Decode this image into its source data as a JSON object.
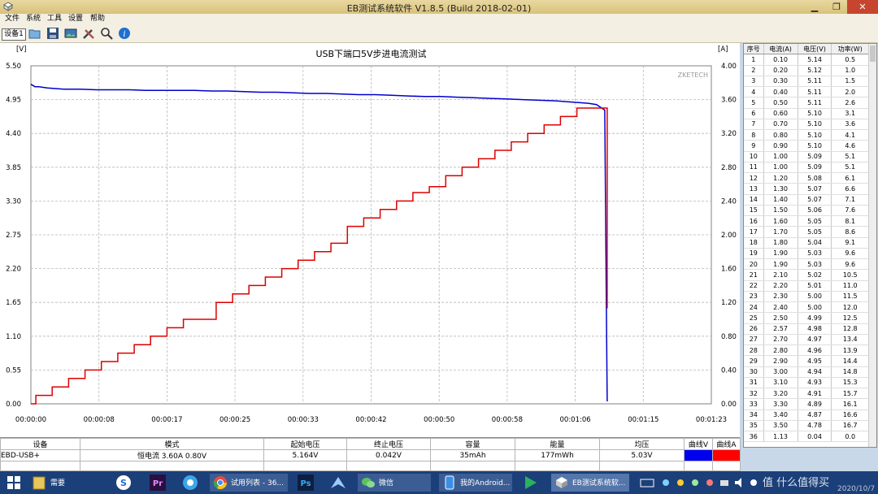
{
  "window": {
    "title": "EB测试系统软件 V1.8.5 (Build 2018-02-01)"
  },
  "menu": [
    "文件",
    "系统",
    "工具",
    "设置",
    "帮助"
  ],
  "toolbar": {
    "device_button": "设备1"
  },
  "chart_data": {
    "type": "line",
    "title": "USB下端口5V步进电流测试",
    "watermark": "ZKETECH",
    "left_unit": "[V]",
    "right_unit": "[A]",
    "left_ticks": [
      "0.00",
      "0.55",
      "1.10",
      "1.65",
      "2.20",
      "2.75",
      "3.30",
      "3.85",
      "4.40",
      "4.95",
      "5.50"
    ],
    "right_ticks": [
      "0.00",
      "0.40",
      "0.80",
      "1.20",
      "1.60",
      "2.00",
      "2.40",
      "2.80",
      "3.20",
      "3.60",
      "4.00"
    ],
    "x_ticks": [
      "00:00:00",
      "00:00:08",
      "00:00:17",
      "00:00:25",
      "00:00:33",
      "00:00:42",
      "00:00:50",
      "00:00:58",
      "00:01:06",
      "00:01:15",
      "00:01:23"
    ],
    "ylim_left": [
      0,
      5.5
    ],
    "ylim_right": [
      0,
      4.0
    ],
    "xlim_seconds": [
      0,
      83
    ],
    "grid": true,
    "series": [
      {
        "axis": "left",
        "color": "#0000cc",
        "x": [
          0,
          0.5,
          1,
          2,
          4,
          6,
          8,
          10,
          12,
          14,
          16,
          18,
          20,
          22,
          24,
          26,
          28,
          30,
          32,
          34,
          36,
          38,
          40,
          42,
          44,
          46,
          48,
          50,
          52,
          54,
          56,
          58,
          60,
          62,
          64,
          66,
          68,
          69,
          70,
          70.2,
          70.3
        ],
        "values": [
          5.2,
          5.16,
          5.16,
          5.14,
          5.12,
          5.12,
          5.11,
          5.11,
          5.11,
          5.1,
          5.1,
          5.1,
          5.1,
          5.09,
          5.09,
          5.08,
          5.07,
          5.07,
          5.06,
          5.05,
          5.05,
          5.04,
          5.03,
          5.03,
          5.02,
          5.01,
          5.0,
          5.0,
          4.99,
          4.98,
          4.97,
          4.96,
          4.95,
          4.94,
          4.93,
          4.91,
          4.89,
          4.87,
          4.78,
          1.55,
          0.04
        ]
      },
      {
        "axis": "right",
        "color": "#dd0000",
        "x": [
          0,
          0.6,
          0.6,
          2.6,
          2.6,
          4.6,
          4.6,
          6.6,
          6.6,
          8.6,
          8.6,
          10.6,
          10.6,
          12.6,
          12.6,
          14.6,
          14.6,
          16.6,
          16.6,
          18.6,
          18.6,
          22.6,
          22.6,
          24.6,
          24.6,
          26.6,
          26.6,
          28.6,
          28.6,
          30.6,
          30.6,
          32.6,
          32.6,
          34.6,
          34.6,
          36.6,
          36.6,
          38.6,
          38.6,
          40.6,
          40.6,
          42.6,
          42.6,
          44.6,
          44.6,
          46.6,
          46.6,
          48.6,
          48.6,
          50.6,
          50.6,
          52.6,
          52.6,
          54.6,
          54.6,
          56.6,
          56.6,
          58.6,
          58.6,
          60.6,
          60.6,
          62.6,
          62.6,
          64.6,
          64.6,
          66.6,
          66.6,
          68.6,
          68.6,
          70.3,
          70.3
        ],
        "values": [
          0,
          0,
          0.1,
          0.1,
          0.2,
          0.2,
          0.3,
          0.3,
          0.4,
          0.4,
          0.5,
          0.5,
          0.6,
          0.6,
          0.7,
          0.7,
          0.8,
          0.8,
          0.9,
          0.9,
          1.0,
          1.0,
          1.2,
          1.2,
          1.3,
          1.3,
          1.4,
          1.4,
          1.5,
          1.5,
          1.6,
          1.6,
          1.7,
          1.7,
          1.8,
          1.8,
          1.9,
          1.9,
          2.1,
          2.1,
          2.2,
          2.2,
          2.3,
          2.3,
          2.4,
          2.4,
          2.5,
          2.5,
          2.57,
          2.57,
          2.7,
          2.7,
          2.8,
          2.8,
          2.9,
          2.9,
          3.0,
          3.0,
          3.1,
          3.1,
          3.2,
          3.2,
          3.3,
          3.3,
          3.4,
          3.4,
          3.5,
          3.5,
          3.5,
          3.5,
          1.13
        ]
      }
    ]
  },
  "right_table": {
    "headers": [
      "序号",
      "电流(A)",
      "电压(V)",
      "功率(W)"
    ],
    "rows": [
      [
        "1",
        "0.10",
        "5.14",
        "0.5"
      ],
      [
        "2",
        "0.20",
        "5.12",
        "1.0"
      ],
      [
        "3",
        "0.30",
        "5.11",
        "1.5"
      ],
      [
        "4",
        "0.40",
        "5.11",
        "2.0"
      ],
      [
        "5",
        "0.50",
        "5.11",
        "2.6"
      ],
      [
        "6",
        "0.60",
        "5.10",
        "3.1"
      ],
      [
        "7",
        "0.70",
        "5.10",
        "3.6"
      ],
      [
        "8",
        "0.80",
        "5.10",
        "4.1"
      ],
      [
        "9",
        "0.90",
        "5.10",
        "4.6"
      ],
      [
        "10",
        "1.00",
        "5.09",
        "5.1"
      ],
      [
        "11",
        "1.00",
        "5.09",
        "5.1"
      ],
      [
        "12",
        "1.20",
        "5.08",
        "6.1"
      ],
      [
        "13",
        "1.30",
        "5.07",
        "6.6"
      ],
      [
        "14",
        "1.40",
        "5.07",
        "7.1"
      ],
      [
        "15",
        "1.50",
        "5.06",
        "7.6"
      ],
      [
        "16",
        "1.60",
        "5.05",
        "8.1"
      ],
      [
        "17",
        "1.70",
        "5.05",
        "8.6"
      ],
      [
        "18",
        "1.80",
        "5.04",
        "9.1"
      ],
      [
        "19",
        "1.90",
        "5.03",
        "9.6"
      ],
      [
        "20",
        "1.90",
        "5.03",
        "9.6"
      ],
      [
        "21",
        "2.10",
        "5.02",
        "10.5"
      ],
      [
        "22",
        "2.20",
        "5.01",
        "11.0"
      ],
      [
        "23",
        "2.30",
        "5.00",
        "11.5"
      ],
      [
        "24",
        "2.40",
        "5.00",
        "12.0"
      ],
      [
        "25",
        "2.50",
        "4.99",
        "12.5"
      ],
      [
        "26",
        "2.57",
        "4.98",
        "12.8"
      ],
      [
        "27",
        "2.70",
        "4.97",
        "13.4"
      ],
      [
        "28",
        "2.80",
        "4.96",
        "13.9"
      ],
      [
        "29",
        "2.90",
        "4.95",
        "14.4"
      ],
      [
        "30",
        "3.00",
        "4.94",
        "14.8"
      ],
      [
        "31",
        "3.10",
        "4.93",
        "15.3"
      ],
      [
        "32",
        "3.20",
        "4.91",
        "15.7"
      ],
      [
        "33",
        "3.30",
        "4.89",
        "16.1"
      ],
      [
        "34",
        "3.40",
        "4.87",
        "16.6"
      ],
      [
        "35",
        "3.50",
        "4.78",
        "16.7"
      ],
      [
        "36",
        "1.13",
        "0.04",
        "0.0"
      ]
    ]
  },
  "bottom_table": {
    "headers": [
      "设备",
      "模式",
      "起始电压",
      "终止电压",
      "容量",
      "能量",
      "均压",
      "曲线V",
      "曲线A"
    ],
    "row": [
      "EBD-USB+",
      "恒电流  3.60A  0.80V",
      "5.164V",
      "0.042V",
      "35mAh",
      "177mWh",
      "5.03V",
      "",
      ""
    ],
    "curve_v_color": "#0000ee",
    "curve_a_color": "#ff0000"
  },
  "taskbar": {
    "items": [
      "需要",
      "试用列表 - 36...",
      "微信",
      "我的Android...",
      "EB测试系统软..."
    ],
    "date": "2020/10/7",
    "watermark": "值 什么值得买"
  }
}
